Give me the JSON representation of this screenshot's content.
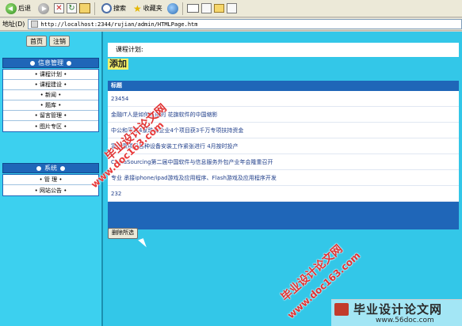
{
  "toolbar": {
    "back_label": "后退",
    "search_label": "搜索",
    "favorites_label": "收藏夹"
  },
  "addressbar": {
    "label": "地址(D)",
    "url": "http://localhost:2344/rujian/admin/HTMLPage.htm"
  },
  "left": {
    "home_button": "首页",
    "logout_button": "注销",
    "menu1": {
      "title": "信息管理",
      "items": [
        "• 课程计划 •",
        "• 课程建设 •",
        "• 新闻 •",
        "• 题库 •",
        "• 留言管理 •",
        "• 图片专区 •"
      ]
    },
    "menu2": {
      "title": "系统",
      "items": [
        "• 管 理 •",
        "• 网站公告 •"
      ]
    }
  },
  "main": {
    "breadcrumb": "课程计划:",
    "add_button": "添加",
    "table_header": "标题",
    "rows": [
      "23454",
      "金融IT人是如何炼成的  花旗软件的中国缩影",
      "中公和平等4家珠海企业4个项目获3千万专项扶持资金",
      "富士康项目各种设备安装工作紧张进行  4月按时投产",
      "ChinaSourcing第二届中国软件与信息服务外包产业年会隆重召开",
      "专业  承接iphone/ipad游戏及应用程序、Flash游戏及应用程序开发",
      "232"
    ],
    "delete_button": "删除所选"
  },
  "watermarks": {
    "text1": "毕业设计论文网",
    "text2": "www.doc163.com",
    "brand_title": "毕业设计论文网",
    "brand_url": "www.56doc.com"
  },
  "colors": {
    "page_bg": "#33c7e8",
    "menu_head": "#1f66b8",
    "watermark": "#e03333",
    "add_button": "#f6f06a"
  }
}
